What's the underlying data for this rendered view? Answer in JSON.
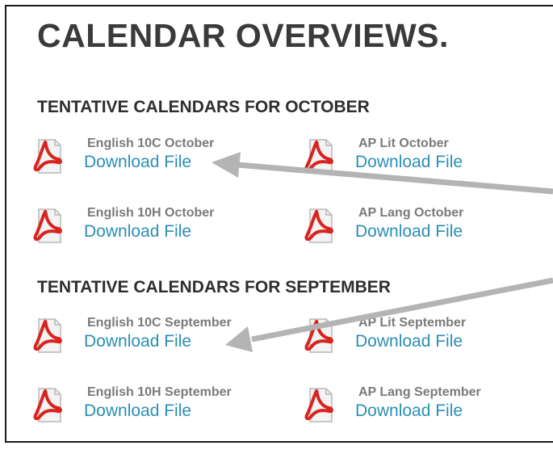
{
  "page": {
    "title": "CALENDAR OVERVIEWS."
  },
  "sections": [
    {
      "heading": "TENTATIVE CALENDARS FOR OCTOBER",
      "files": [
        {
          "name": "English 10C October",
          "link_label": "Download File",
          "icon": "pdf-icon"
        },
        {
          "name": "AP Lit October",
          "link_label": "Download File",
          "icon": "pdf-icon"
        },
        {
          "name": "English 10H October",
          "link_label": "Download File",
          "icon": "pdf-icon"
        },
        {
          "name": "AP Lang October",
          "link_label": "Download File",
          "icon": "pdf-icon"
        }
      ]
    },
    {
      "heading": "TENTATIVE CALENDARS FOR SEPTEMBER",
      "files": [
        {
          "name": "English 10C September",
          "link_label": "Download File",
          "icon": "pdf-icon"
        },
        {
          "name": "AP Lit September",
          "link_label": "Download File",
          "icon": "pdf-icon"
        },
        {
          "name": "English 10H September",
          "link_label": "Download File",
          "icon": "pdf-icon"
        },
        {
          "name": "AP Lang September",
          "link_label": "Download File",
          "icon": "pdf-icon"
        }
      ]
    }
  ],
  "colors": {
    "title": "#3a3a3a",
    "link": "#2a8fb5",
    "file_name": "#7a7a7a",
    "pdf_red": "#d8231f",
    "annotation_arrow": "#b4b4b4"
  },
  "annotations": [
    {
      "type": "arrow",
      "points_to": "English 10C October download link"
    },
    {
      "type": "arrow",
      "points_to": "English 10C September download link"
    }
  ]
}
